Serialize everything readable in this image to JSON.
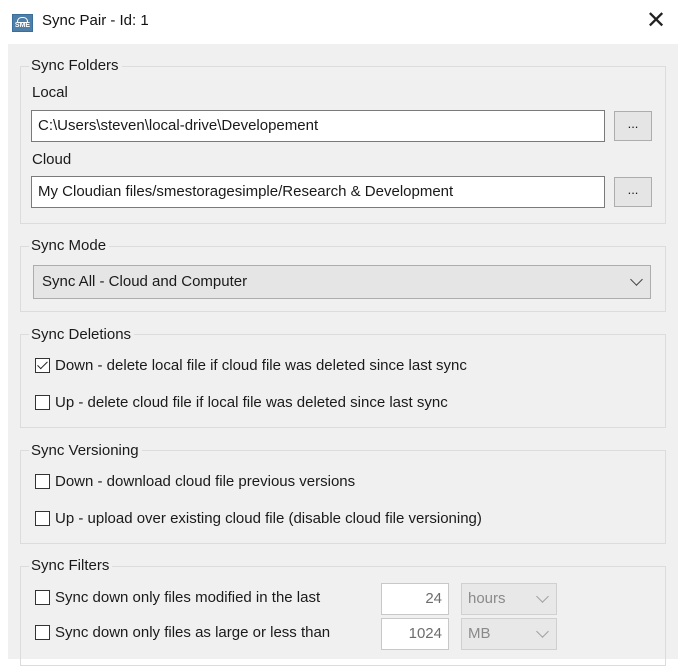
{
  "window": {
    "title": "Sync Pair - Id: 1",
    "app_icon": "sme-cloud-icon",
    "app_icon_text": "SME",
    "close_glyph": "✕"
  },
  "sync_folders": {
    "legend": "Sync Folders",
    "local_label": "Local",
    "local_value": "C:\\Users\\steven\\local-drive\\Developement",
    "local_browse": "...",
    "cloud_label": "Cloud",
    "cloud_value": "My Cloudian files/smestoragesimple/Research & Development",
    "cloud_browse": "..."
  },
  "sync_mode": {
    "legend": "Sync Mode",
    "selected": "Sync All - Cloud and Computer"
  },
  "sync_deletions": {
    "legend": "Sync Deletions",
    "down": {
      "label": "Down - delete local file if cloud file was deleted since last sync",
      "checked": true
    },
    "up": {
      "label": "Up - delete cloud file if local file was deleted since last sync",
      "checked": false
    }
  },
  "sync_versioning": {
    "legend": "Sync Versioning",
    "down": {
      "label": "Down - download cloud file previous versions",
      "checked": false
    },
    "up": {
      "label": "Up - upload over existing cloud file (disable cloud file versioning)",
      "checked": false
    }
  },
  "sync_filters": {
    "legend": "Sync Filters",
    "modified": {
      "label": "Sync down only files modified in the last",
      "checked": false,
      "value": "24",
      "unit": "hours"
    },
    "size": {
      "label": "Sync down only files as large or less than",
      "checked": false,
      "value": "1024",
      "unit": "MB"
    }
  },
  "colors": {
    "dialog_background": "#f0f0f0",
    "title_background": "#ffffff",
    "group_border": "#dcdcdc"
  }
}
